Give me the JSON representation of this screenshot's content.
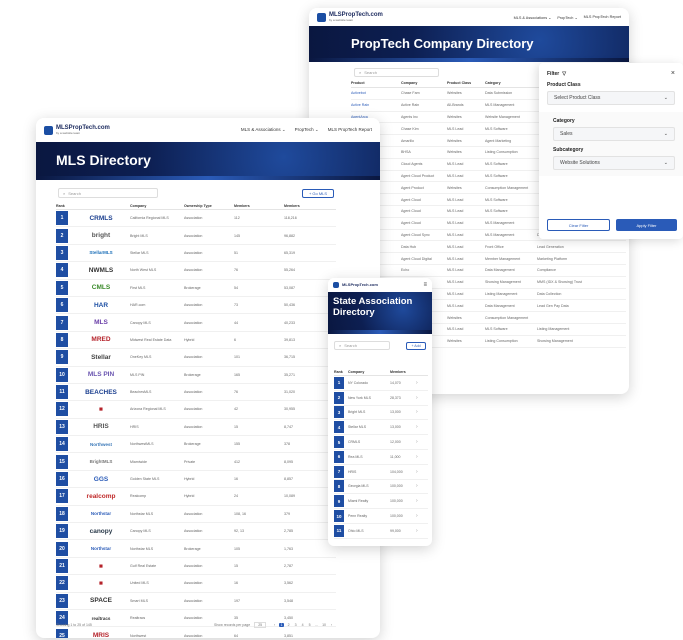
{
  "brand": {
    "name": "MLSPropTech.com",
    "sub": "by a website team"
  },
  "nav": [
    "MLS & Associations ⌄",
    "PropTech ⌄",
    "MLS PropTech Report"
  ],
  "nav_short": [
    "MLS & Associations ⌄",
    "PropTech ⌄",
    "MLS PropTech Report"
  ],
  "proptech": {
    "title": "PropTech Company Directory",
    "search_placeholder": "Search",
    "headers": [
      "Product",
      "Company",
      "Product Class",
      "Category"
    ],
    "rows": [
      [
        "Activebot",
        "Chase Fam",
        "Websites",
        "Data Submission"
      ],
      [
        "Active Rain",
        "Active Rain",
        "All-Brands",
        "MLS Management"
      ],
      [
        "AgentArca",
        "Agents Inc",
        "Websites",
        "Website Management"
      ],
      [
        "Alfred",
        "Chase Kim",
        "MLS Lead",
        "MLS Software"
      ],
      [
        "Amarillo",
        "Amarillo",
        "Websites",
        "Agent Marketing"
      ],
      [
        "BHSA",
        "BHSA",
        "Websites",
        "Listing Consumption"
      ],
      [
        "Bluetooth",
        "Cloud Agents",
        "MLS Lead",
        "MLS Software"
      ],
      [
        "Brokerage",
        "Agent Cloud Product",
        "MLS Lead",
        "MLS Software"
      ],
      [
        "Buildium",
        "Agent Product",
        "Websites",
        "Consumption Management"
      ],
      [
        "CMLS",
        "Agent Cloud",
        "MLS Lead",
        "MLS Software"
      ],
      [
        "Cloud",
        "Agent Cloud",
        "MLS Lead",
        "MLS Software"
      ],
      [
        "Cleanup",
        "Agent Cloud",
        "MLS Lead",
        "MLS Management"
      ],
      [
        "Cloud Sync",
        "Agent Cloud Sync",
        "MLS Lead",
        "MLS Management"
      ],
      [
        "Data Hub",
        "Data Hub",
        "MLS Lead",
        "Front Office"
      ],
      [
        "Digital",
        "Agent Cloud Digital",
        "MLS Lead",
        "Member Management"
      ],
      [
        "Echo",
        "Echo",
        "MLS Lead",
        "Data Management"
      ],
      [
        "Elevate",
        "Elevate",
        "MLS Lead",
        "Showing Management"
      ],
      [
        "Flex",
        "Flex",
        "MLS Lead",
        "Listing Management"
      ],
      [
        "Focus",
        "Focus",
        "MLS Lead",
        "Data Management"
      ],
      [
        "Gateway",
        "Gateway",
        "Websites",
        "Consumption Management"
      ],
      [
        "Insight",
        "Insight",
        "MLS Lead",
        "MLS Software"
      ],
      [
        "Journey",
        "Journey",
        "Websites",
        "Listing Consumption"
      ]
    ],
    "extra_col": [
      "",
      "",
      "",
      "",
      "",
      "",
      "",
      "",
      "",
      "",
      "",
      "",
      "Data Distribution",
      "Lead Generation",
      "Marketing Platform",
      "Compliance",
      "MMS (IDX & Showing) Trust",
      "Data Collection",
      "Lead Gen Pay Data",
      "",
      "Listing Management",
      "Showing Management",
      "Data & Engineering",
      "Virtual Tours"
    ]
  },
  "filter": {
    "title": "Filter",
    "close": "×",
    "product_class_label": "Product Class",
    "product_class_value": "Select Product Class",
    "category_label": "Category",
    "category_value": "Sales",
    "subcategory_label": "Subcategory",
    "subcategory_value": "Website Solutions",
    "clear": "Clear Filter",
    "apply": "Apply Filter"
  },
  "mls": {
    "title": "MLS Directory",
    "search_placeholder": "Search",
    "add_button": "+ Go MLS",
    "headers": [
      "Rank",
      "Company",
      "Ownership Type",
      "Members",
      "Members"
    ],
    "rows": [
      {
        "rank": "1",
        "logo": "CRMLS",
        "name": "California Regional MLS",
        "type": "Association",
        "a": "112",
        "b": "118,216"
      },
      {
        "rank": "2",
        "logo": "bright",
        "name": "Bright MLS",
        "type": "Association",
        "a": "145",
        "b": "96,882"
      },
      {
        "rank": "3",
        "logo": "StellarMLS",
        "name": "Stellar MLS",
        "type": "Association",
        "a": "51",
        "b": "65,319"
      },
      {
        "rank": "4",
        "logo": "NWMLS",
        "name": "North West MLS",
        "type": "Association",
        "a": "76",
        "b": "55,264"
      },
      {
        "rank": "5",
        "logo": "CMLS",
        "name": "First MLS",
        "type": "Brokerage",
        "a": "54",
        "b": "53,087"
      },
      {
        "rank": "6",
        "logo": "HAR",
        "name": "HAR.com",
        "type": "Association",
        "a": "73",
        "b": "50,436"
      },
      {
        "rank": "7",
        "logo": "MLS",
        "name": "Canopy MLS",
        "type": "Association",
        "a": "44",
        "b": "40,233"
      },
      {
        "rank": "8",
        "logo": "MRED",
        "name": "Midwest Real Estate Data",
        "type": "Hybrid",
        "a": "6",
        "b": "39,813"
      },
      {
        "rank": "9",
        "logo": "Stellar",
        "name": "OneKey MLS",
        "type": "Association",
        "a": "101",
        "b": "36,715"
      },
      {
        "rank": "10",
        "logo": "MLS PIN",
        "name": "MLS PIN",
        "type": "Brokerage",
        "a": "165",
        "b": "35,271"
      },
      {
        "rank": "11",
        "logo": "BEACHES",
        "name": "BeachesMLS",
        "type": "Association",
        "a": "76",
        "b": "31,020"
      },
      {
        "rank": "12",
        "logo": "■",
        "name": "Arizona Regional MLS",
        "type": "Association",
        "a": "42",
        "b": "30,955"
      },
      {
        "rank": "13",
        "logo": "HRIS",
        "name": "HRIS",
        "type": "Association",
        "a": "15",
        "b": "8,747"
      },
      {
        "rank": "14",
        "logo": "Northwest",
        "name": "NorthwestMLS",
        "type": "Brokerage",
        "a": "155",
        "b": "378"
      },
      {
        "rank": "15",
        "logo": "BrightMLS",
        "name": "Miamiwide",
        "type": "Private",
        "a": "412",
        "b": "8,095"
      },
      {
        "rank": "16",
        "logo": "GGS",
        "name": "Golden State MLS",
        "type": "Hybrid",
        "a": "16",
        "b": "8,857"
      },
      {
        "rank": "17",
        "logo": "realcomp",
        "name": "Realcomp",
        "type": "Hybrid",
        "a": "24",
        "b": "10,089"
      },
      {
        "rank": "18",
        "logo": "Northstar",
        "name": "Northstar MLS",
        "type": "Association",
        "a": "108, 16",
        "b": "379"
      },
      {
        "rank": "19",
        "logo": "canopy",
        "name": "Canopy MLS",
        "type": "Association",
        "a": "92, 13",
        "b": "2,785"
      },
      {
        "rank": "20",
        "logo": "Northstar",
        "name": "Northstar MLS",
        "type": "Brokerage",
        "a": "105",
        "b": "1,763"
      },
      {
        "rank": "21",
        "logo": "■",
        "name": "Gulf Real Estate",
        "type": "Association",
        "a": "15",
        "b": "2,787"
      },
      {
        "rank": "22",
        "logo": "■",
        "name": "United MLS",
        "type": "Association",
        "a": "16",
        "b": "3,562"
      },
      {
        "rank": "23",
        "logo": "SPACE",
        "name": "Smart MLS",
        "type": "Association",
        "a": "197",
        "b": "3,548"
      },
      {
        "rank": "24",
        "logo": "realtracs",
        "name": "Realtracs",
        "type": "Association",
        "a": "35",
        "b": "3,450"
      },
      {
        "rank": "25",
        "logo": "MRIS",
        "name": "Northwest",
        "type": "Association",
        "a": "64",
        "b": "3,851"
      }
    ],
    "footer_left": "Showing 1 to 25 of 145",
    "footer_mid": "Show records per page",
    "per_page": "25",
    "pages": [
      "‹",
      "1",
      "2",
      "3",
      "4",
      "5",
      "...",
      "10",
      "›"
    ]
  },
  "state": {
    "title": "State Association Directory",
    "search_placeholder": "Search",
    "add_button": "+ Add",
    "headers": [
      "Rank",
      "Company",
      "Members"
    ],
    "rows": [
      [
        "1",
        "NY Colorado",
        "14,070"
      ],
      [
        "2",
        "New York MLS",
        "28,373"
      ],
      [
        "3",
        "Bright MLS",
        "13,000"
      ],
      [
        "4",
        "Stellar MLS",
        "13,000"
      ],
      [
        "5",
        "CRMLS",
        "12,000"
      ],
      [
        "6",
        "Rea MLS",
        "11,000"
      ],
      [
        "7",
        "HRIS",
        "104,000"
      ],
      [
        "8",
        "Georgia MLS",
        "100,000"
      ],
      [
        "9",
        "Miami Realty",
        "100,000"
      ],
      [
        "10",
        "Penn Realty",
        "100,000"
      ],
      [
        "11",
        "Ohio MLS",
        "99,000"
      ]
    ]
  }
}
